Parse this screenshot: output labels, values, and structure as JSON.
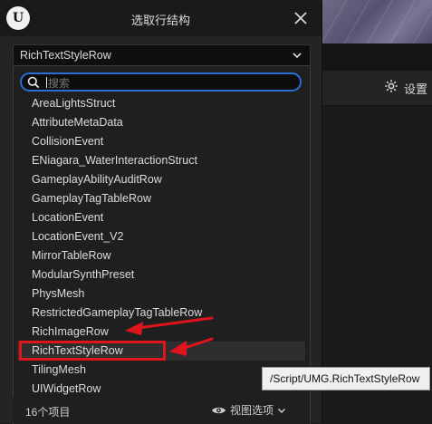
{
  "dialog": {
    "title": "选取行结构",
    "combo_value": "RichTextStyleRow"
  },
  "search": {
    "placeholder": "搜索",
    "value": ""
  },
  "list": {
    "items": [
      "AreaLightsStruct",
      "AttributeMetaData",
      "CollisionEvent",
      "ENiagara_WaterInteractionStruct",
      "GameplayAbilityAuditRow",
      "GameplayTagTableRow",
      "LocationEvent",
      "LocationEvent_V2",
      "MirrorTableRow",
      "ModularSynthPreset",
      "PhysMesh",
      "RestrictedGameplayTagTableRow",
      "RichImageRow",
      "RichTextStyleRow",
      "TilingMesh",
      "UIWidgetRow"
    ],
    "selected": "RichTextStyleRow"
  },
  "footer": {
    "count": "16个项目",
    "view_options": "视图选项"
  },
  "tooltip": {
    "text": "/Script/UMG.RichTextStyleRow"
  },
  "background": {
    "settings_label": "设置"
  },
  "icons": {
    "logo": "unreal-logo-icon",
    "close": "close-icon",
    "chevron": "chevron-down-icon",
    "search": "search-icon",
    "eye": "eye-icon",
    "gear": "gear-icon"
  },
  "colors": {
    "accent": "#2a6fd4",
    "annotation": "#e0141c"
  }
}
